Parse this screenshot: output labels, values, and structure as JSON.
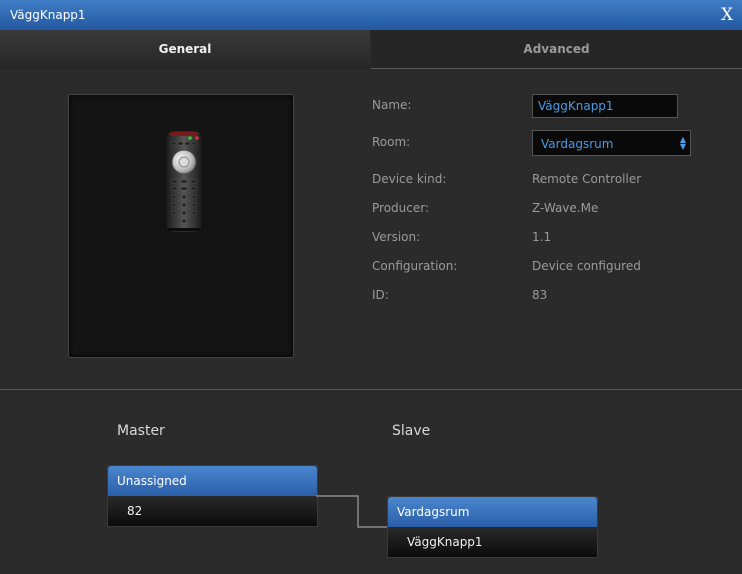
{
  "window": {
    "title": "VäggKnapp1",
    "close_label": "X"
  },
  "tabs": [
    {
      "label": "General",
      "active": true
    },
    {
      "label": "Advanced",
      "active": false
    }
  ],
  "device": {
    "icon": "remote-controller-icon",
    "fields": {
      "name": {
        "label": "Name:",
        "value": "VäggKnapp1"
      },
      "room": {
        "label": "Room:",
        "value": "Vardagsrum"
      },
      "device_kind": {
        "label": "Device kind:",
        "value": "Remote Controller"
      },
      "producer": {
        "label": "Producer:",
        "value": "Z-Wave.Me"
      },
      "version": {
        "label": "Version:",
        "value": "1.1"
      },
      "configuration": {
        "label": "Configuration:",
        "value": "Device configured"
      },
      "id": {
        "label": "ID:",
        "value": "83"
      }
    }
  },
  "associations": {
    "master": {
      "heading": "Master",
      "group_name": "Unassigned",
      "item": "82"
    },
    "slave": {
      "heading": "Slave",
      "group_name": "Vardagsrum",
      "item": "VäggKnapp1"
    }
  },
  "colors": {
    "accent": "#3f7dc6",
    "value_text": "#4a9ae8",
    "background": "#2b2b2b"
  }
}
